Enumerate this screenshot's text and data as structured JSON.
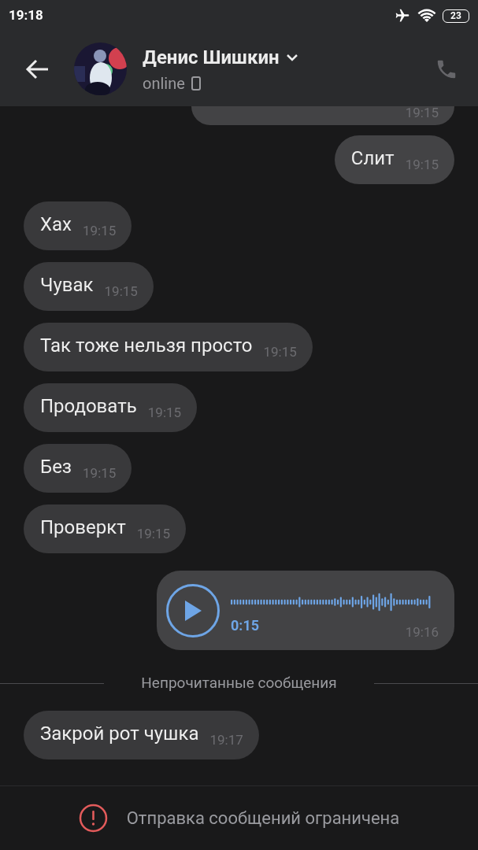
{
  "status_bar": {
    "time": "19:18",
    "battery": "23"
  },
  "header": {
    "name": "Денис Шишкин",
    "status": "online"
  },
  "messages": [
    {
      "kind": "text",
      "outgoing": true,
      "clipped": true,
      "time": "19:15"
    },
    {
      "kind": "text",
      "outgoing": true,
      "text": "Слит",
      "time": "19:15"
    },
    {
      "kind": "text",
      "outgoing": false,
      "text": "Хах",
      "time": "19:15"
    },
    {
      "kind": "text",
      "outgoing": false,
      "text": "Чувак",
      "time": "19:15"
    },
    {
      "kind": "text",
      "outgoing": false,
      "text": "Так тоже нельзя просто",
      "time": "19:15"
    },
    {
      "kind": "text",
      "outgoing": false,
      "text": "Продовать",
      "time": "19:15"
    },
    {
      "kind": "text",
      "outgoing": false,
      "text": "Без",
      "time": "19:15"
    },
    {
      "kind": "text",
      "outgoing": false,
      "text": "Проверкт",
      "time": "19:15"
    },
    {
      "kind": "voice",
      "outgoing": true,
      "duration": "0:15",
      "time": "19:16"
    },
    {
      "kind": "divider",
      "text": "Непрочитанные сообщения"
    },
    {
      "kind": "text",
      "outgoing": false,
      "text": "Закрой рот чушка",
      "time": "19:17"
    }
  ],
  "footer": {
    "notice": "Отправка сообщений ограничена"
  }
}
